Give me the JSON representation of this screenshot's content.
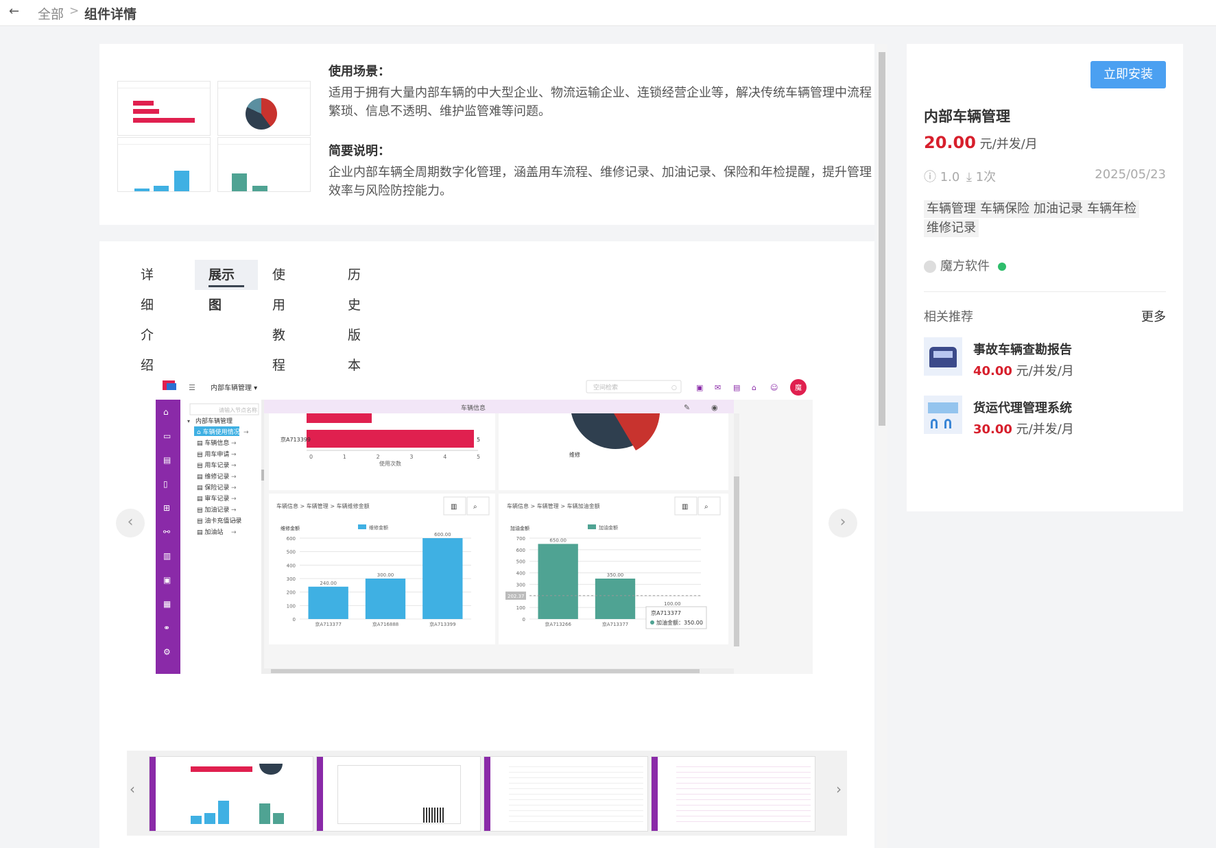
{
  "breadcrumb": {
    "back": "←",
    "root": "全部",
    "separator": ">",
    "current": "组件详情"
  },
  "intro": {
    "scenario_title": "使用场景：",
    "scenario_text_1": "适用于拥有大量内部车辆的中大型企业、物流运输企业、连锁经营企业等，解决传统车辆管理中流程",
    "scenario_text_2": "繁琐、信息不透明、维护监管难等问题。",
    "brief_title": "简要说明：",
    "brief_text_1": "企业内部车辆全周期数字化管理，涵盖用车流程、维修记录、加油记录、保险和年检提醒，提升管理",
    "brief_text_2": "效率与风险防控能力。"
  },
  "tabs": [
    {
      "label": "详细介绍",
      "active": false
    },
    {
      "label": "展示图",
      "active": true
    },
    {
      "label": "使用教程",
      "active": false
    },
    {
      "label": "历史版本",
      "active": false
    }
  ],
  "carousel": {
    "prev": "‹",
    "next": "›"
  },
  "shot": {
    "app_title": "内部车辆管理 ▾",
    "search_placeholder": "空间检索",
    "user_badge": "魔",
    "tree_search": "请输入节点名称",
    "tree_root": "内部车辆管理",
    "tree_items": [
      "车辆使用情况",
      "车辆信息",
      "用车申请",
      "用车记录",
      "维修记录",
      "保险记录",
      "审车记录",
      "加油记录",
      "油卡充值记录",
      "加油站"
    ],
    "top_panel_title": "车辆信息",
    "hbar_label": "京A713399",
    "hbar_value": "5",
    "hbar_axis": [
      "0",
      "1",
      "2",
      "3",
      "4",
      "5"
    ],
    "hbar_axis_title": "使用次数",
    "pie_label": "维修",
    "panel_left": {
      "breadcrumb": "车辆信息 > 车辆管理 > 车辆维修金额",
      "ylabel": "维修金额",
      "legend": "维修金额",
      "yticks": [
        "600",
        "500",
        "400",
        "300",
        "200",
        "100",
        "0"
      ]
    },
    "panel_right": {
      "breadcrumb": "车辆信息 > 车辆管理 > 车辆加油金额",
      "ylabel": "加油金额",
      "legend": "加油金额",
      "yticks": [
        "700",
        "600",
        "500",
        "400",
        "300",
        "200",
        "100",
        "0"
      ],
      "avg_label": "202.37",
      "tooltip_title": "京A713377",
      "tooltip_text": "加油金额：350.00"
    }
  },
  "chart_data": [
    {
      "type": "bar",
      "title": "",
      "ylabel": "维修金额",
      "categories": [
        "京A713377",
        "京A716888",
        "京A713399"
      ],
      "series": [
        {
          "name": "维修金额",
          "values": [
            240.0,
            300.0,
            600.0
          ]
        }
      ],
      "ylim": [
        0,
        600
      ],
      "color": "#3fb0e3"
    },
    {
      "type": "bar",
      "title": "",
      "ylabel": "加油金额",
      "categories": [
        "京A713266",
        "京A713377",
        ""
      ],
      "series": [
        {
          "name": "加油金额",
          "values": [
            650.0,
            350.0,
            100.0
          ]
        }
      ],
      "ylim": [
        0,
        700
      ],
      "color": "#4fa393"
    }
  ],
  "product": {
    "install_label": "立即安装",
    "name": "内部车辆管理",
    "price": "20.00",
    "price_unit": " 元/并发/月",
    "version": "ⓘ 1.0",
    "downloads": "⤓ 1次",
    "date": "2025/05/23",
    "tags": [
      "车辆管理",
      "车辆保险",
      "加油记录",
      "车辆年检",
      "维修记录"
    ],
    "author": "魔方软件"
  },
  "related": {
    "title": "相关推荐",
    "more": "更多",
    "items": [
      {
        "name": "事故车辆查勘报告",
        "price": "40.00",
        "unit": " 元/并发/月"
      },
      {
        "name": "货运代理管理系统",
        "price": "30.00",
        "unit": " 元/并发/月"
      }
    ]
  },
  "colors": {
    "accent": "#4ba0f1",
    "price": "#d71f2c",
    "app_sidebar": "#8a2aa8",
    "hbar": "#e0204f",
    "bar_blue": "#3fb0e3",
    "bar_green": "#4fa393",
    "pie_dark": "#2f3f4f",
    "pie_red": "#c8332e"
  }
}
